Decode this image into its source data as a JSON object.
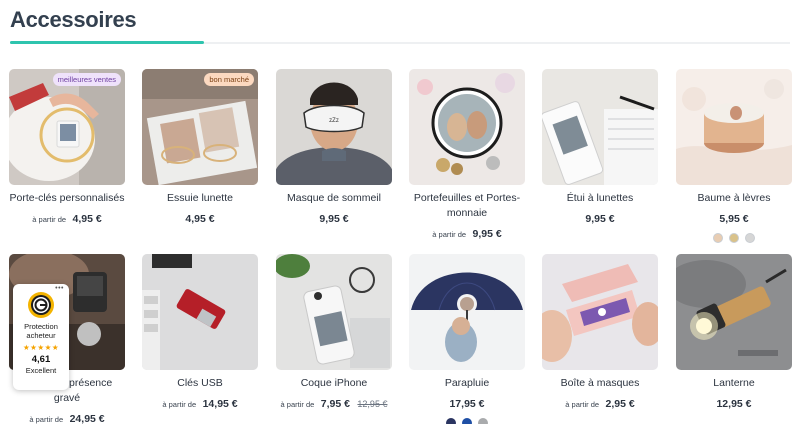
{
  "section": {
    "title": "Accessoires"
  },
  "colors": {
    "accent": "#2ec4ae",
    "text": "#2c3440",
    "badge_purple": "#efe2fb",
    "badge_orange": "#fcd9c0"
  },
  "products": [
    {
      "name": "Porte-clés personnalisés",
      "from": "à partir de",
      "price": "4,95 €",
      "badge": "meilleures ventes",
      "image": "keychain-photo"
    },
    {
      "name": "Essuie lunette",
      "price": "4,95 €",
      "badge": "bon marché",
      "image": "lens-cloth-photo"
    },
    {
      "name": "Masque de sommeil",
      "price": "9,95 €",
      "image": "sleep-mask-photo"
    },
    {
      "name": "Portefeuilles et Portes-monnaie",
      "from": "à partir de",
      "price": "9,95 €",
      "image": "coin-purse-photo"
    },
    {
      "name": "Étui à lunettes",
      "price": "9,95 €",
      "image": "glasses-case-photo"
    },
    {
      "name": "Baume à lèvres",
      "price": "5,95 €",
      "image": "lip-balm-photo",
      "swatches": [
        "#e8cdb3",
        "#d9c28a",
        "#d6d6d6"
      ]
    },
    {
      "name": "Pendentif présence gravé",
      "from": "à partir de",
      "price": "24,95 €",
      "image": "pendant-photo"
    },
    {
      "name": "Clés USB",
      "from": "à partir de",
      "price": "14,95 €",
      "image": "usb-stick-photo"
    },
    {
      "name": "Coque iPhone",
      "from": "à partir de",
      "price": "7,95 €",
      "old_price": "12,95 €",
      "image": "phone-case-photo"
    },
    {
      "name": "Parapluie",
      "price": "17,95 €",
      "image": "umbrella-photo",
      "swatches": [
        "#2b3561",
        "#1f4fa5",
        "#a9abad"
      ]
    },
    {
      "name": "Boîte à masques",
      "from": "à partir de",
      "price": "2,95 €",
      "image": "mask-box-photo"
    },
    {
      "name": "Lanterne",
      "price": "12,95 €",
      "image": "flashlight-photo"
    }
  ],
  "trust_badge": {
    "label": "Protection acheteur",
    "stars": "★★★★★",
    "score": "4,61",
    "rating_word": "Excellent",
    "menu": "•••"
  }
}
